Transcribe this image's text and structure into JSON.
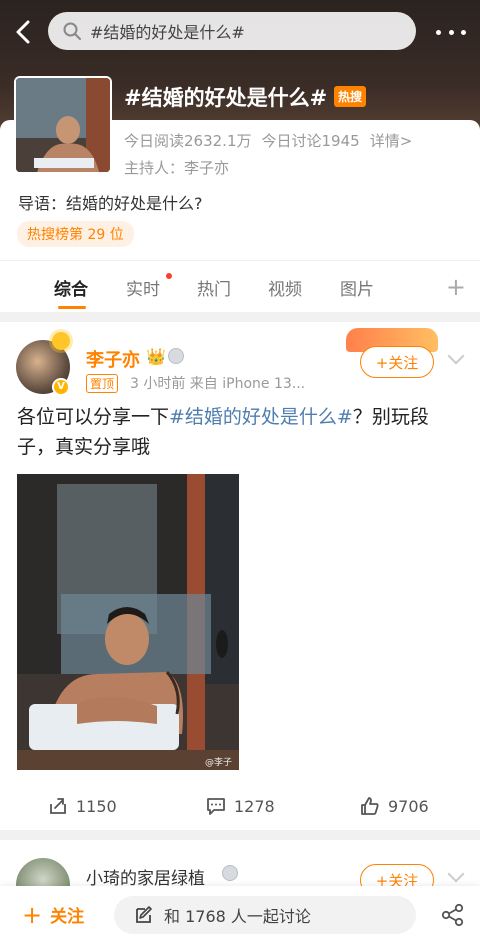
{
  "search": {
    "query": "#结婚的好处是什么#"
  },
  "topic": {
    "title": "#结婚的好处是什么#",
    "badge": "热搜",
    "reads": "今日阅读2632.1万",
    "discussions": "今日讨论1945",
    "details": "详情>",
    "host": "主持人：李子亦",
    "guide": "导语：结婚的好处是什么?",
    "rank": "热搜榜第 29 位"
  },
  "tabs": [
    {
      "label": "综合",
      "active": true
    },
    {
      "label": "实时",
      "active": false
    },
    {
      "label": "热门",
      "active": false
    },
    {
      "label": "视频",
      "active": false
    },
    {
      "label": "图片",
      "active": false
    }
  ],
  "post": {
    "author": "李子亦",
    "pinned": "置顶",
    "meta": "3 小时前  来自 iPhone 13...",
    "follow": "+关注",
    "text_prefix": "各位可以分享一下",
    "text_tag": "#结婚的好处是什么#",
    "text_suffix": "？别玩段子，真实分享哦",
    "watermark": "@李子亦",
    "reposts": "1150",
    "comments": "1278",
    "likes": "9706"
  },
  "post2": {
    "author": "小琦的家居绿植",
    "follow": "+关注"
  },
  "bottom": {
    "follow": "关注",
    "discuss": "和 1768 人一起讨论"
  },
  "colors": {
    "accent": "#ff8200",
    "link": "#507daf"
  }
}
